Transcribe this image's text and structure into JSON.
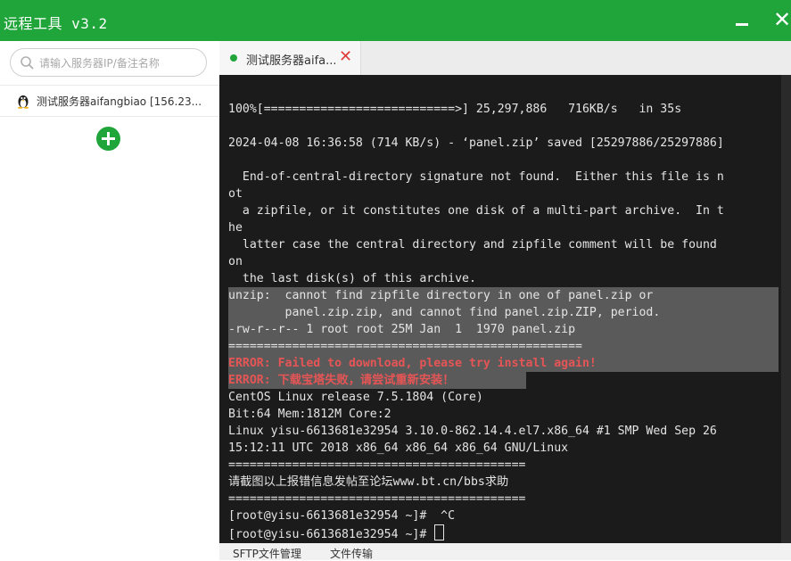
{
  "app": {
    "title": "远程工具 v3.2",
    "minimize_glyph": "—",
    "close_glyph": "✕"
  },
  "sidebar": {
    "search": {
      "placeholder": "请输入服务器IP/备注名称",
      "value": ""
    },
    "servers": [
      {
        "name": "测试服务器aifangbiao [156.23...",
        "icon": "linux-icon"
      }
    ],
    "add_icon": "plus-icon"
  },
  "tabs": [
    {
      "label": "测试服务器aifa...",
      "status_color": "#20a53a",
      "close_glyph": "✕"
    }
  ],
  "terminal": {
    "lines": [
      "100%[===========================>] 25,297,886   716KB/s   in 35s",
      "",
      "2024-04-08 16:36:58 (714 KB/s) - ‘panel.zip’ saved [25297886/25297886]",
      "",
      "  End-of-central-directory signature not found.  Either this file is n",
      "ot",
      "  a zipfile, or it constitutes one disk of a multi-part archive.  In t",
      "he",
      "  latter case the central directory and zipfile comment will be found",
      "on",
      "  the last disk(s) of this archive.",
      "unzip:  cannot find zipfile directory in one of panel.zip or",
      "        panel.zip.zip, and cannot find panel.zip.ZIP, period.",
      "-rw-r--r-- 1 root root 25M Jan  1  1970 panel.zip",
      "==================================================",
      "ERROR: Failed to download, please try install again!",
      "ERROR: 下载宝塔失败，请尝试重新安装！",
      "CentOS Linux release 7.5.1804 (Core)",
      "Bit:64 Mem:1812M Core:2",
      "Linux yisu-6613681e32954 3.10.0-862.14.4.el7.x86_64 #1 SMP Wed Sep 26",
      "15:12:11 UTC 2018 x86_64 x86_64 x86_64 GNU/Linux",
      "==========================================",
      "请截图以上报错信息发帖至论坛www.bt.cn/bbs求助",
      "==========================================",
      "[root@yisu-6613681e32954 ~]#  ^C",
      "[root@yisu-6613681e32954 ~]# "
    ]
  },
  "bottom_tabs": [
    {
      "label": "SFTP文件管理"
    },
    {
      "label": "文件传输"
    }
  ],
  "colors": {
    "brand": "#20a53a",
    "terminal_bg": "#1b1b1b",
    "error": "#e65555",
    "highlight": "#5a5a5a"
  }
}
